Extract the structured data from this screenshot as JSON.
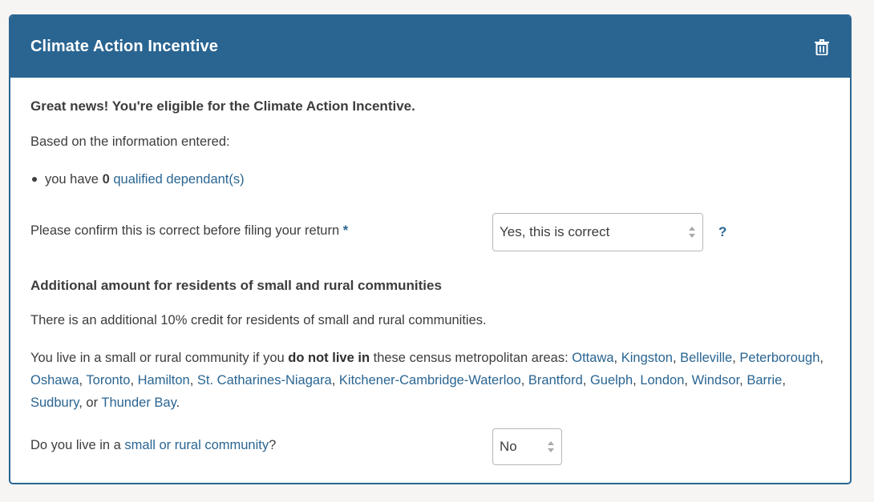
{
  "card": {
    "title": "Climate Action Incentive",
    "delete_icon": "trash-icon"
  },
  "eligibility": {
    "heading": "Great news! You're eligible for the Climate Action Incentive.",
    "based_on": "Based on the information entered:",
    "bullet_prefix": "you have",
    "dependant_count": "0",
    "dependant_link": "qualified dependant(s)"
  },
  "confirm": {
    "label": "Please confirm this is correct before filing your return",
    "required_mark": "*",
    "selected": "Yes, this is correct",
    "help": "?"
  },
  "rural": {
    "heading": "Additional amount for residents of small and rural communities",
    "credit_text": "There is an additional 10% credit for residents of small and rural communities.",
    "live_prefix": "You live in a small or rural community if you ",
    "live_bold": "do not live in",
    "live_suffix": " these census metropolitan areas: ",
    "cities": [
      "Ottawa",
      "Kingston",
      "Belleville",
      "Peterborough",
      "Oshawa",
      "Toronto",
      "Hamilton",
      "St. Catharines-Niagara",
      "Kitchener-Cambridge-Waterloo",
      "Brantford",
      "Guelph",
      "London",
      "Windsor",
      "Barrie",
      "Sudbury",
      "Thunder Bay"
    ],
    "or_word": "or",
    "end_period": ".",
    "question_prefix": "Do you live in a ",
    "question_link": "small or rural community",
    "question_suffix": "?",
    "selected": "No"
  },
  "colors": {
    "primary": "#2a6592",
    "text": "#3d3d3d",
    "background": "#f6f5f4"
  }
}
